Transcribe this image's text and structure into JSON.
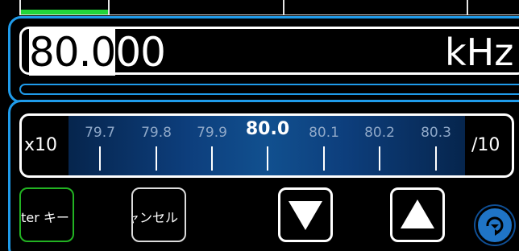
{
  "frequency": {
    "selected_part": "80.0",
    "remaining_part": "00",
    "unit": "kHz"
  },
  "scale": {
    "multiply_label": "x10",
    "divide_label": "/10",
    "ticks": [
      "79.7",
      "79.8",
      "79.9",
      "80.0",
      "80.1",
      "80.2",
      "80.3"
    ],
    "center_tick": "80.0"
  },
  "buttons": {
    "enter_label": "nter キー",
    "cancel_label": "ャンセル",
    "down_icon": "triangle-down-icon",
    "up_icon": "triangle-up-icon",
    "round_icon": "rotate-icon"
  },
  "colors": {
    "accent_blue": "#1f9bea",
    "enter_green": "#22b322",
    "top_green": "#22d63a",
    "round_button_blue": "#1f74c6"
  }
}
